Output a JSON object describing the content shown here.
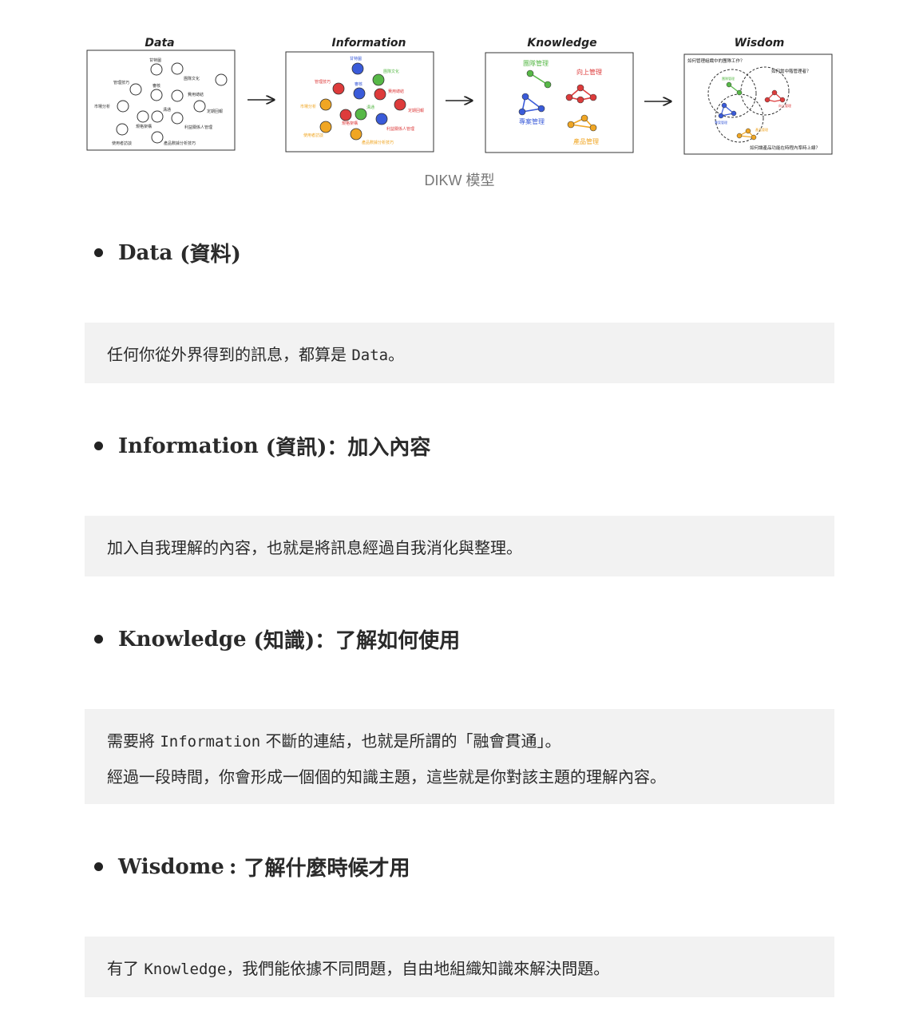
{
  "figure": {
    "panels": [
      {
        "title": "Data",
        "labels": [
          "甘特圖",
          "團隊文化",
          "管理技巧",
          "審核",
          "費用總結",
          "市場分析",
          "溝通",
          "定期回報",
          "規格架構",
          "利益關係人管理",
          "使用者訪談",
          "產品數據分析技巧"
        ]
      },
      {
        "title": "Information",
        "labels": [
          "甘特圖",
          "團隊文化",
          "管理技巧",
          "審核",
          "費用總結",
          "市場分析",
          "溝通",
          "定期回報",
          "規格架構",
          "利益關係人管理",
          "使用者訪談",
          "產品數據分析技巧"
        ]
      },
      {
        "title": "Knowledge",
        "labels": [
          "團隊管理",
          "向上管理",
          "專案管理",
          "產品管理"
        ]
      },
      {
        "title": "Wisdom",
        "labels": [
          "如何管理組織中的團隊工作？",
          "如何當中階管理者？",
          "團隊管理",
          "向上管理",
          "專案管理",
          "產品管理",
          "如何讓產品功能在時程內準時上線？"
        ]
      }
    ],
    "caption": "DIKW 模型",
    "colors": {
      "blue": "#3a5bd9",
      "green": "#57b847",
      "red": "#dd3b3b",
      "orange": "#f0a623"
    }
  },
  "sections": [
    {
      "term": "Data",
      "heading_cn": "(資料)",
      "heading_rest": "",
      "lines": [
        {
          "pre": "任何你從外界得到的訊息，都算是 ",
          "mono": "Data",
          "post": "。"
        }
      ]
    },
    {
      "term": "Information",
      "heading_cn": "(資訊)",
      "heading_rest": "：加入內容",
      "lines": [
        {
          "pre": "加入自我理解的內容，也就是將訊息經過自我消化與整理。",
          "mono": "",
          "post": ""
        }
      ]
    },
    {
      "term": "Knowledge",
      "heading_cn": "(知識)",
      "heading_rest": "：了解如何使用",
      "lines": [
        {
          "pre": "需要將 ",
          "mono": "Information",
          "post": " 不斷的連結，也就是所謂的「融會貫通」。"
        },
        {
          "pre": "經過一段時間，你會形成一個個的知識主題，這些就是你對該主題的理解內容。",
          "mono": "",
          "post": ""
        }
      ]
    },
    {
      "term": "Wisdome",
      "heading_cn": ":",
      "heading_rest": " 了解什麼時候才用",
      "lines": [
        {
          "pre": "有了 ",
          "mono": "Knowledge",
          "post": "，我們能依據不同問題，自由地組織知識來解決問題。"
        }
      ]
    }
  ]
}
